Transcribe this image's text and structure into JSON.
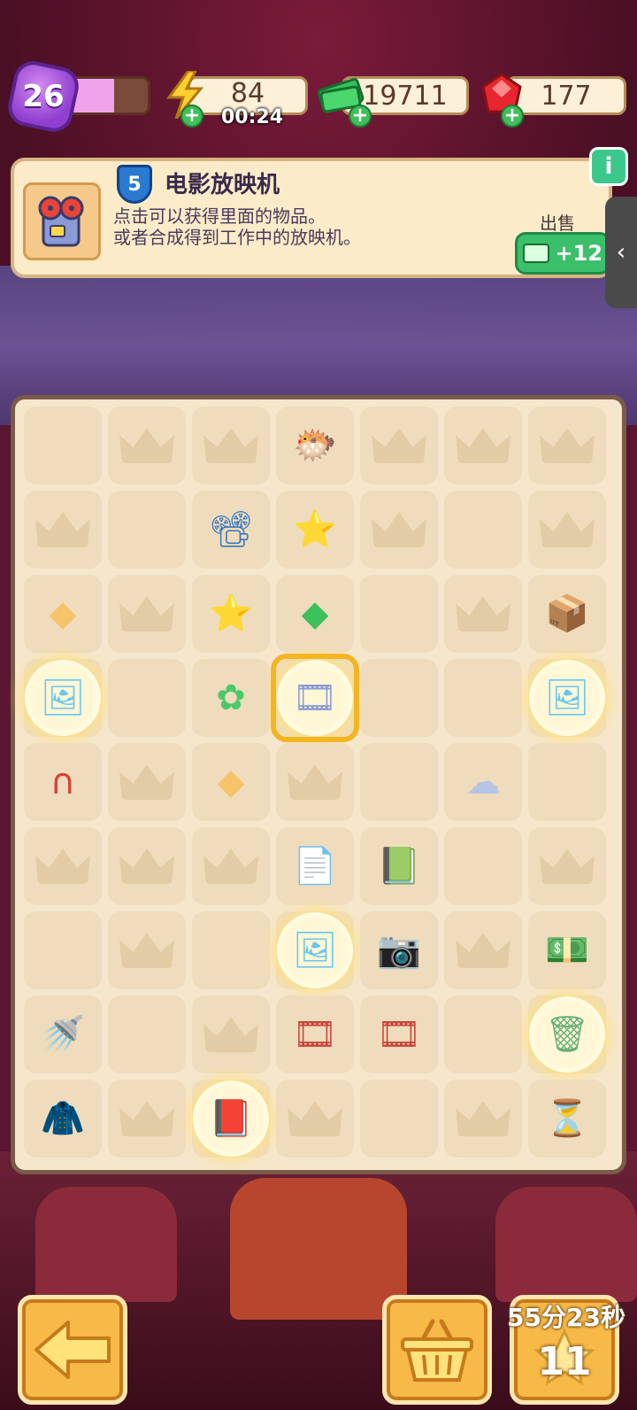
{
  "hud": {
    "level": "26",
    "level_progress": 0.55,
    "energy": "84",
    "energy_timer": "00:24",
    "cash": "19711",
    "gems": "177"
  },
  "info": {
    "item_level": "5",
    "title": "电影放映机",
    "desc_line1": "点击可以获得里面的物品。",
    "desc_line2": "或者合成得到工作中的放映机。",
    "sell_label": "出售",
    "sell_value": "+12",
    "info_icon": "i",
    "side_tab_icon": "‹"
  },
  "board": {
    "rows": 9,
    "cols": 7,
    "items": [
      {
        "row": 0,
        "col": 3,
        "name": "pufferfish-item",
        "glyph": "🐡"
      },
      {
        "row": 1,
        "col": 2,
        "name": "projector-generator-item",
        "glyph": "📽"
      },
      {
        "row": 1,
        "col": 3,
        "name": "angel-star-item",
        "glyph": "⭐"
      },
      {
        "row": 2,
        "col": 0,
        "name": "popcorn-kernel-item",
        "glyph": "◆"
      },
      {
        "row": 2,
        "col": 2,
        "name": "winged-star-item",
        "glyph": "⭐"
      },
      {
        "row": 2,
        "col": 3,
        "name": "green-gem-item",
        "glyph": "◆"
      },
      {
        "row": 2,
        "col": 6,
        "name": "camera-box-item",
        "glyph": "📦"
      },
      {
        "row": 3,
        "col": 0,
        "name": "glowing-screen-item",
        "glyph": "🖼"
      },
      {
        "row": 3,
        "col": 2,
        "name": "angel-blob-item",
        "glyph": "✿"
      },
      {
        "row": 3,
        "col": 3,
        "name": "movie-projector-item",
        "glyph": "🎞"
      },
      {
        "row": 3,
        "col": 6,
        "name": "glowing-screen-item",
        "glyph": "🖼"
      },
      {
        "row": 4,
        "col": 0,
        "name": "magnet-item",
        "glyph": "∩"
      },
      {
        "row": 4,
        "col": 2,
        "name": "popcorn-pile-item",
        "glyph": "◆"
      },
      {
        "row": 4,
        "col": 5,
        "name": "crumpled-paper-item",
        "glyph": "☁"
      },
      {
        "row": 5,
        "col": 3,
        "name": "sketch-paper-item",
        "glyph": "📄"
      },
      {
        "row": 5,
        "col": 4,
        "name": "lightning-book-item",
        "glyph": "📗"
      },
      {
        "row": 6,
        "col": 3,
        "name": "glowing-screen-item",
        "glyph": "🖼"
      },
      {
        "row": 6,
        "col": 4,
        "name": "camera-generator-item",
        "glyph": "📷"
      },
      {
        "row": 6,
        "col": 6,
        "name": "cash-stack-item",
        "glyph": "💵"
      },
      {
        "row": 7,
        "col": 0,
        "name": "watering-can-item",
        "glyph": "🚿"
      },
      {
        "row": 7,
        "col": 3,
        "name": "film-reel-item",
        "glyph": "🎞"
      },
      {
        "row": 7,
        "col": 4,
        "name": "film-strip-item",
        "glyph": "🎞"
      },
      {
        "row": 7,
        "col": 6,
        "name": "glowing-bin-item",
        "glyph": "🗑"
      },
      {
        "row": 8,
        "col": 0,
        "name": "detective-coat-item",
        "glyph": "🧥"
      },
      {
        "row": 8,
        "col": 2,
        "name": "glowing-book-item",
        "glyph": "📕"
      },
      {
        "row": 8,
        "col": 6,
        "name": "hourglass-item",
        "glyph": "⏳"
      }
    ],
    "glowing": [
      "3-0",
      "3-3",
      "3-6",
      "6-3",
      "7-6",
      "8-2"
    ],
    "selected": "3-3",
    "empty_no_crown": [
      "0-0",
      "1-1",
      "1-5",
      "2-4",
      "3-1",
      "3-4",
      "3-5",
      "4-4",
      "4-6",
      "5-5",
      "6-0",
      "6-2",
      "7-1",
      "7-5",
      "8-4"
    ]
  },
  "bottom": {
    "back_icon": "⬅",
    "basket_icon": "🧺",
    "countdown": "55分23秒",
    "energy_count": "11"
  },
  "colors": {
    "accent": "#f7b948",
    "board_bg": "#f6e6cc",
    "cell_bg": "#efdcbd",
    "sell_green": "#3cbf6a",
    "select_gold": "#f5b521"
  }
}
